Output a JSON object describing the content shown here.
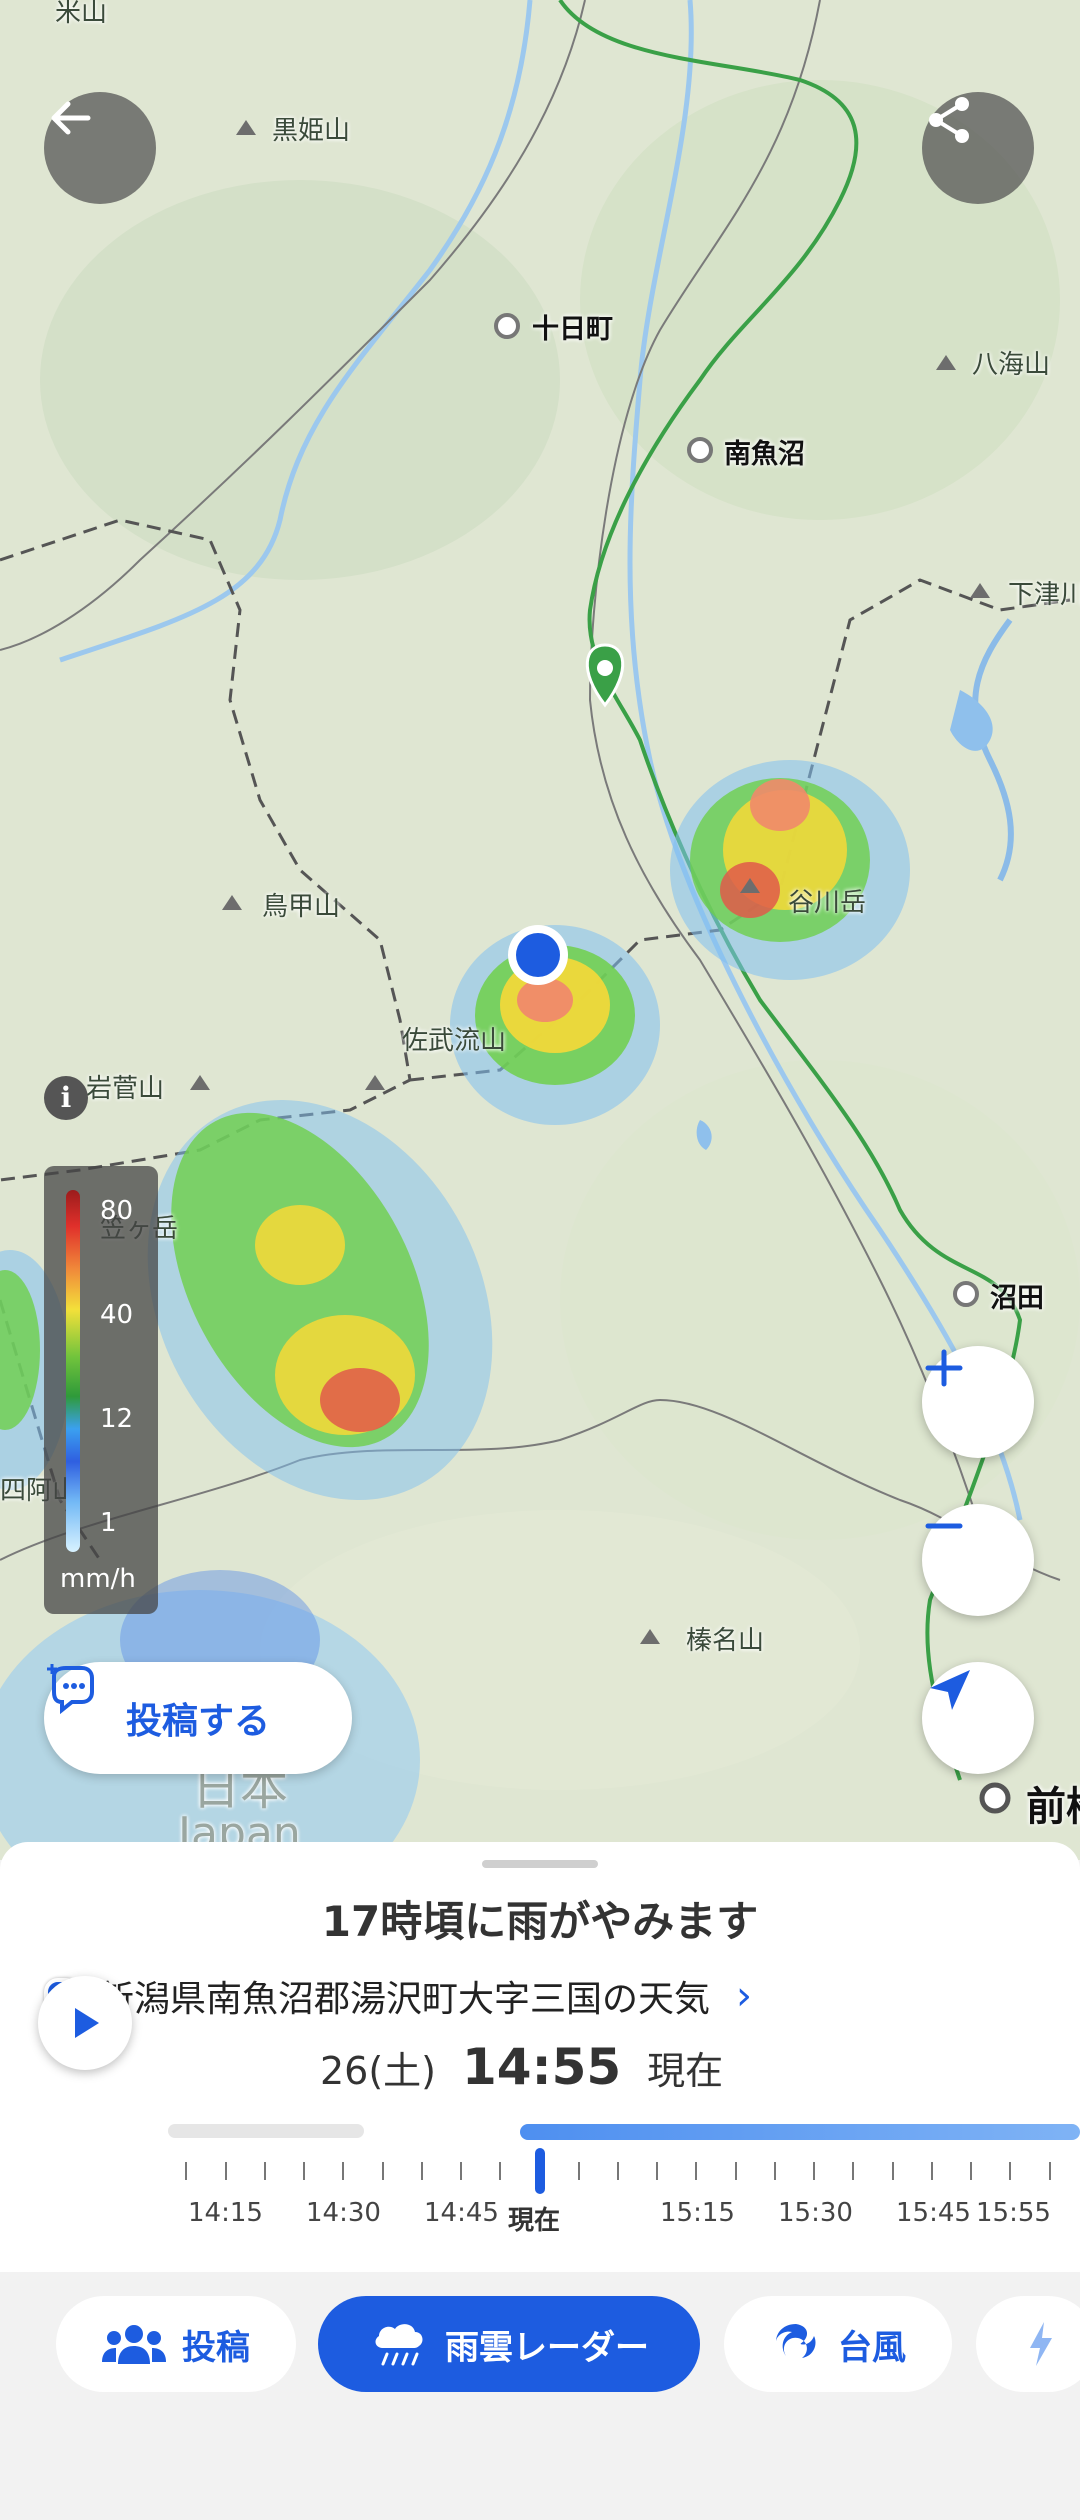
{
  "map": {
    "places": {
      "kurohime": "黒姫山",
      "torikabuto": "鳥甲山",
      "iwasuge": "岩菅山",
      "hachikai": "八海山",
      "shimotsu": "下津川",
      "tanigawa": "谷川岳",
      "sabu": "佐武流山",
      "haruna": "榛名山",
      "kasaga": "笠ヶ岳",
      "azumaya": "四阿山",
      "top_left": "米山"
    },
    "cities": {
      "tokamachi": "十日町",
      "minamiuonuma": "南魚沼",
      "numata": "沼田",
      "maebashi": "前橋"
    },
    "japan_kanji": "日本",
    "japan_latin": "Japan"
  },
  "legend": {
    "labels": [
      "80",
      "40",
      "12",
      "1"
    ],
    "unit": "mm/h"
  },
  "buttons": {
    "post_label": "投稿する"
  },
  "sheet": {
    "headline": "17時頃に雨がやみます",
    "location": "新潟県南魚沼郡湯沢町大字三国の天気",
    "date": "26(土)",
    "time": "14:55",
    "now_label": "現在",
    "timeline_labels": [
      "14:15",
      "14:30",
      "14:45",
      "現在",
      "15:15",
      "15:30",
      "15:45",
      "15:55"
    ]
  },
  "nav": {
    "tabs": [
      {
        "label": "投稿",
        "icon": "people-icon"
      },
      {
        "label": "雨雲レーダー",
        "icon": "rain-cloud-icon"
      },
      {
        "label": "台風",
        "icon": "typhoon-icon"
      },
      {
        "label": "",
        "icon": "lightning-icon"
      }
    ],
    "active_tab": "雨雲レーダー"
  },
  "colors": {
    "accent": "#1d5ce0",
    "rail": "#3aa047"
  }
}
